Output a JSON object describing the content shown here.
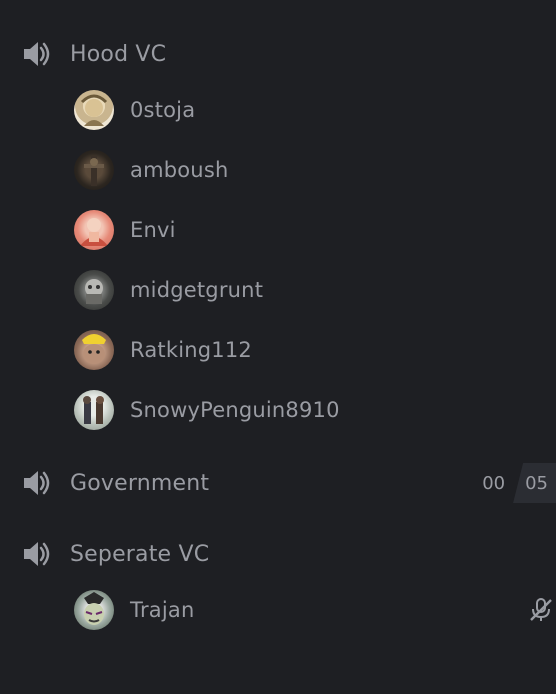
{
  "channels": [
    {
      "name": "Hood VC",
      "icon": "speaker-icon"
    },
    {
      "name": "Government",
      "icon": "speaker-icon"
    },
    {
      "name": "Seperate VC",
      "icon": "speaker-icon"
    }
  ],
  "hood_members": [
    {
      "name": "0stoja"
    },
    {
      "name": "amboush"
    },
    {
      "name": "Envi"
    },
    {
      "name": "midgetgrunt"
    },
    {
      "name": "Ratking112"
    },
    {
      "name": "SnowyPenguin8910"
    }
  ],
  "government_counter": {
    "a": "00",
    "b": "05"
  },
  "separate_members": [
    {
      "name": "Trajan",
      "status_icon": "mic-muted-icon"
    }
  ],
  "colors": {
    "background": "#1e1f23",
    "text": "#9a9ca3",
    "counter_bg": "#2b2d33"
  }
}
